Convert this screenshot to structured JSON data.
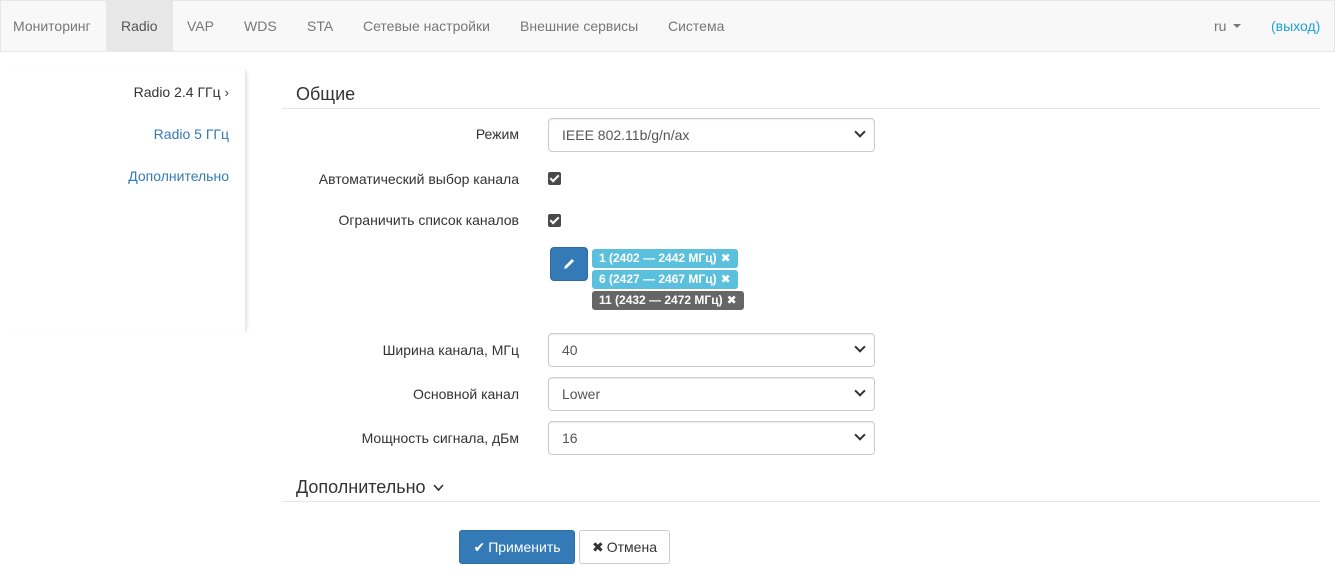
{
  "nav": {
    "items": [
      {
        "label": "Мониторинг"
      },
      {
        "label": "Radio",
        "active": true
      },
      {
        "label": "VAP"
      },
      {
        "label": "WDS"
      },
      {
        "label": "STA"
      },
      {
        "label": "Сетевые настройки"
      },
      {
        "label": "Внешние сервисы"
      },
      {
        "label": "Система"
      }
    ],
    "lang": "ru",
    "logout": "(выход)"
  },
  "sidebar": {
    "items": [
      {
        "label": "Radio 2.4 ГГц",
        "active": true,
        "chevron": "›"
      },
      {
        "label": "Radio 5 ГГц"
      },
      {
        "label": "Дополнительно"
      }
    ]
  },
  "general": {
    "title": "Общие",
    "mode": {
      "label": "Режим",
      "value": "IEEE 802.11b/g/n/ax"
    },
    "auto_channel": {
      "label": "Автоматический выбор канала",
      "checked": true
    },
    "limit_channels": {
      "label": "Ограничить список каналов",
      "checked": true
    },
    "channels": [
      {
        "label": "1 (2402 — 2442 МГц)",
        "remove": "✖"
      },
      {
        "label": "6 (2427 — 2467 МГц)",
        "remove": "✖"
      },
      {
        "label": "11 (2432 — 2472 МГц)",
        "remove": "✖"
      }
    ],
    "width": {
      "label": "Ширина канала, МГц",
      "value": "40"
    },
    "primary": {
      "label": "Основной канал",
      "value": "Lower"
    },
    "power": {
      "label": "Мощность сигнала, дБм",
      "value": "16"
    }
  },
  "advanced": {
    "title": "Дополнительно",
    "chevron": "⌄"
  },
  "actions": {
    "apply": {
      "label": "Применить",
      "icon": "✔"
    },
    "cancel": {
      "label": "Отмена",
      "icon": "✖"
    }
  },
  "colors": {
    "navbar_bg": "#f8f8f8",
    "active_tab": "#e7e7e7",
    "link": "#337ab7",
    "logout": "#1aa3d9",
    "tag_info": "#5bc0de",
    "tag_dark": "#666666",
    "primary": "#337ab7"
  }
}
